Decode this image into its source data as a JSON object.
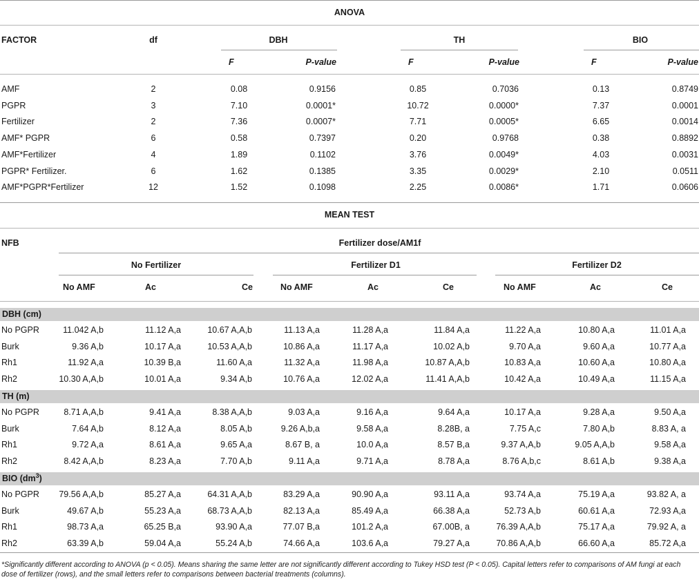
{
  "anova": {
    "title": "ANOVA",
    "col_factor": "FACTOR",
    "col_df": "df",
    "groups": [
      "DBH",
      "TH",
      "BIO"
    ],
    "sub_f": "F",
    "sub_p": "P-value",
    "rows": [
      {
        "factor": "AMF",
        "df": "2",
        "vals": [
          "0.08",
          "0.9156",
          "0.85",
          "0.7036",
          "0.13",
          "0.8749"
        ]
      },
      {
        "factor": "PGPR",
        "df": "3",
        "vals": [
          "7.10",
          "0.0001*",
          "10.72",
          "0.0000*",
          "7.37",
          "0.0001"
        ]
      },
      {
        "factor": "Fertilizer",
        "df": "2",
        "vals": [
          "7.36",
          "0.0007*",
          "7.71",
          "0.0005*",
          "6.65",
          "0.0014"
        ]
      },
      {
        "factor": "AMF* PGPR",
        "df": "6",
        "vals": [
          "0.58",
          "0.7397",
          "0.20",
          "0.9768",
          "0.38",
          "0.8892"
        ]
      },
      {
        "factor": "AMF*Fertilizer",
        "df": "4",
        "vals": [
          "1.89",
          "0.1102",
          "3.76",
          "0.0049*",
          "4.03",
          "0.0031"
        ]
      },
      {
        "factor": "PGPR* Fertilizer.",
        "df": "6",
        "vals": [
          "1.62",
          "0.1385",
          "3.35",
          "0.0029*",
          "2.10",
          "0.0511"
        ]
      },
      {
        "factor": "AMF*PGPR*Fertilizer",
        "df": "12",
        "vals": [
          "1.52",
          "0.1098",
          "2.25",
          "0.0086*",
          "1.71",
          "0.0606"
        ]
      }
    ]
  },
  "mean_test": {
    "title": "MEAN TEST",
    "col_nfb": "NFB",
    "span_header": "Fertilizer dose/AM1f",
    "fert_groups": [
      "No Fertilizer",
      "Fertilizer D1",
      "Fertilizer D2"
    ],
    "amf_cols": [
      "No AMF",
      "Ac",
      "Ce"
    ],
    "sections": [
      {
        "label": "DBH (cm)",
        "rows": [
          {
            "name": "No PGPR",
            "vals": [
              "11.042 A,b",
              "11.12 A,a",
              "10.67 A,A,b",
              "11.13 A,a",
              "11.28 A,a",
              "11.84 A,a",
              "11.22 A,a",
              "10.80 A,a",
              "11.01 A,a"
            ]
          },
          {
            "name": "Burk",
            "vals": [
              "9.36 A,b",
              "10.17 A,a",
              "10.53 A,A,b",
              "10.86 A,a",
              "11.17 A,a",
              "10.02 A,b",
              "9.70 A,a",
              "9.60 A,a",
              "10.77 A,a"
            ]
          },
          {
            "name": "Rh1",
            "vals": [
              "11.92 A,a",
              "10.39 B,a",
              "11.60 A,a",
              "11.32 A,a",
              "11.98 A,a",
              "10.87 A,A,b",
              "10.83 A,a",
              "10.60 A,a",
              "10.80 A,a"
            ]
          },
          {
            "name": "Rh2",
            "vals": [
              "10.30 A,A,b",
              "10.01 A,a",
              "9.34 A,b",
              "10.76 A,a",
              "12.02 A,a",
              "11.41 A,A,b",
              "10.42 A,a",
              "10.49 A,a",
              "11.15 A,a"
            ]
          }
        ]
      },
      {
        "label": "TH (m)",
        "rows": [
          {
            "name": "No PGPR",
            "vals": [
              "8.71 A,A,b",
              "9.41 A,a",
              "8.38 A,A,b",
              "9.03 A,a",
              "9.16 A,a",
              "9.64 A,a",
              "10.17 A,a",
              "9.28 A,a",
              "9.50 A,a"
            ]
          },
          {
            "name": "Burk",
            "vals": [
              "7.64 A,b",
              "8.12 A,a",
              "8.05 A,b",
              "9.26 A,b,a",
              "9.58 A,a",
              "8.28B, a",
              "7.75 A,c",
              "7.80 A,b",
              "8.83 A, a"
            ]
          },
          {
            "name": "Rh1",
            "vals": [
              "9.72 A,a",
              "8.61 A,a",
              "9.65 A,a",
              "8.67 B, a",
              "10.0 A,a",
              "8.57 B,a",
              "9.37 A,A,b",
              "9.05 A,A,b",
              "9.58 A,a"
            ]
          },
          {
            "name": "Rh2",
            "vals": [
              "8.42 A,A,b",
              "8.23 A,a",
              "7.70 A,b",
              "9.11 A,a",
              "9.71 A,a",
              "8.78 A,a",
              "8.76 A,b,c",
              "8.61 A,b",
              "9.38 A,a"
            ]
          }
        ]
      },
      {
        "label": "BIO (dm3)",
        "rows": [
          {
            "name": "No PGPR",
            "vals": [
              "79.56 A,A,b",
              "85.27 A,a",
              "64.31 A,A,b",
              "83.29 A,a",
              "90.90 A,a",
              "93.11 A,a",
              "93.74 A,a",
              "75.19 A,a",
              "93.82 A, a"
            ]
          },
          {
            "name": "Burk",
            "vals": [
              "49.67 A,b",
              "55.23 A,a",
              "68.73 A,A,b",
              "82.13 A,a",
              "85.49 A,a",
              "66.38 A,a",
              "52.73 A,b",
              "60.61 A,a",
              "72.93 A,a"
            ]
          },
          {
            "name": "Rh1",
            "vals": [
              "98.73 A,a",
              "65.25 B,a",
              "93.90 A,a",
              "77.07 B,a",
              "101.2 A,a",
              "67.00B, a",
              "76.39 A,A,b",
              "75.17 A,a",
              "79.92 A, a"
            ]
          },
          {
            "name": "Rh2",
            "vals": [
              "63.39 A,b",
              "59.04 A,a",
              "55.24 A,b",
              "74.66 A,a",
              "103.6 A,a",
              "79.27 A,a",
              "70.86 A,A,b",
              "66.60 A,a",
              "85.72 A,a"
            ]
          }
        ]
      }
    ]
  },
  "footnote": "*Significantly different according to ANOVA (p < 0.05). Means sharing the same letter are not significantly different according to Tukey HSD test (P < 0.05). Capital letters refer to comparisons of AM fungi at each dose of fertilizer (rows), and the small letters refer to comparisons between bacterial treatments (columns)."
}
